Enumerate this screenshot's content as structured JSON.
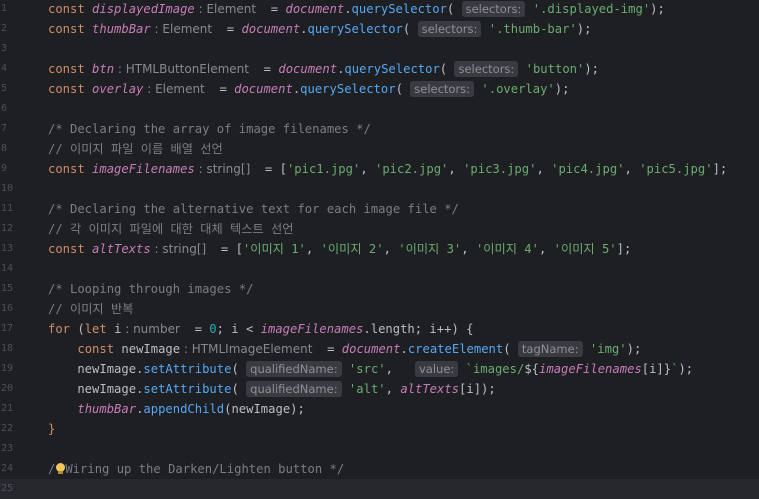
{
  "editor": {
    "lines": [
      {
        "n": "1",
        "tokens": [
          {
            "t": "kw",
            "v": "const "
          },
          {
            "t": "var",
            "v": "displayedImage"
          },
          {
            "t": "hint",
            "v": " : Element"
          },
          {
            "t": "txt",
            "v": "  = "
          },
          {
            "t": "var",
            "v": "document"
          },
          {
            "t": "txt",
            "v": "."
          },
          {
            "t": "fn",
            "v": "querySelector"
          },
          {
            "t": "txt",
            "v": "( "
          },
          {
            "t": "ph",
            "v": "selectors:"
          },
          {
            "t": "str",
            "v": " '.displayed-img'"
          },
          {
            "t": "txt",
            "v": ");"
          }
        ]
      },
      {
        "n": "2",
        "tokens": [
          {
            "t": "kw",
            "v": "const "
          },
          {
            "t": "var",
            "v": "thumbBar"
          },
          {
            "t": "hint",
            "v": " : Element"
          },
          {
            "t": "txt",
            "v": "  = "
          },
          {
            "t": "var",
            "v": "document"
          },
          {
            "t": "txt",
            "v": "."
          },
          {
            "t": "fn",
            "v": "querySelector"
          },
          {
            "t": "txt",
            "v": "( "
          },
          {
            "t": "ph",
            "v": "selectors:"
          },
          {
            "t": "str",
            "v": " '.thumb-bar'"
          },
          {
            "t": "txt",
            "v": ");"
          }
        ]
      },
      {
        "n": "3",
        "tokens": []
      },
      {
        "n": "4",
        "tokens": [
          {
            "t": "kw",
            "v": "const "
          },
          {
            "t": "var",
            "v": "btn"
          },
          {
            "t": "hint",
            "v": " : HTMLButtonElement"
          },
          {
            "t": "txt",
            "v": "  = "
          },
          {
            "t": "var",
            "v": "document"
          },
          {
            "t": "txt",
            "v": "."
          },
          {
            "t": "fn",
            "v": "querySelector"
          },
          {
            "t": "txt",
            "v": "( "
          },
          {
            "t": "ph",
            "v": "selectors:"
          },
          {
            "t": "str",
            "v": " 'button'"
          },
          {
            "t": "txt",
            "v": ");"
          }
        ]
      },
      {
        "n": "5",
        "tokens": [
          {
            "t": "kw",
            "v": "const "
          },
          {
            "t": "var",
            "v": "overlay"
          },
          {
            "t": "hint",
            "v": " : Element"
          },
          {
            "t": "txt",
            "v": "  = "
          },
          {
            "t": "var",
            "v": "document"
          },
          {
            "t": "txt",
            "v": "."
          },
          {
            "t": "fn",
            "v": "querySelector"
          },
          {
            "t": "txt",
            "v": "( "
          },
          {
            "t": "ph",
            "v": "selectors:"
          },
          {
            "t": "str",
            "v": " '.overlay'"
          },
          {
            "t": "txt",
            "v": ");"
          }
        ]
      },
      {
        "n": "6",
        "tokens": []
      },
      {
        "n": "7",
        "tokens": [
          {
            "t": "cmt",
            "v": "/* Declaring the array of image filenames */"
          }
        ]
      },
      {
        "n": "8",
        "tokens": [
          {
            "t": "cmt",
            "v": "// 이미지 파일 이름 배열 선언"
          }
        ]
      },
      {
        "n": "9",
        "tokens": [
          {
            "t": "kw",
            "v": "const "
          },
          {
            "t": "var",
            "v": "imageFilenames"
          },
          {
            "t": "hint",
            "v": " : string[]"
          },
          {
            "t": "txt",
            "v": "  = ["
          },
          {
            "t": "str",
            "v": "'pic1.jpg'"
          },
          {
            "t": "txt",
            "v": ", "
          },
          {
            "t": "str",
            "v": "'pic2.jpg'"
          },
          {
            "t": "txt",
            "v": ", "
          },
          {
            "t": "str",
            "v": "'pic3.jpg'"
          },
          {
            "t": "txt",
            "v": ", "
          },
          {
            "t": "str",
            "v": "'pic4.jpg'"
          },
          {
            "t": "txt",
            "v": ", "
          },
          {
            "t": "str",
            "v": "'pic5.jpg'"
          },
          {
            "t": "txt",
            "v": "];"
          }
        ]
      },
      {
        "n": "10",
        "tokens": []
      },
      {
        "n": "11",
        "tokens": [
          {
            "t": "cmt",
            "v": "/* Declaring the alternative text for each image file */"
          }
        ]
      },
      {
        "n": "12",
        "tokens": [
          {
            "t": "cmt",
            "v": "// 각 이미지 파일에 대한 대체 텍스트 선언"
          }
        ]
      },
      {
        "n": "13",
        "tokens": [
          {
            "t": "kw",
            "v": "const "
          },
          {
            "t": "var",
            "v": "altTexts"
          },
          {
            "t": "hint",
            "v": " : string[]"
          },
          {
            "t": "txt",
            "v": "  = ["
          },
          {
            "t": "str",
            "v": "'이미지 1'"
          },
          {
            "t": "txt",
            "v": ", "
          },
          {
            "t": "str",
            "v": "'이미지 2'"
          },
          {
            "t": "txt",
            "v": ", "
          },
          {
            "t": "str",
            "v": "'이미지 3'"
          },
          {
            "t": "txt",
            "v": ", "
          },
          {
            "t": "str",
            "v": "'이미지 4'"
          },
          {
            "t": "txt",
            "v": ", "
          },
          {
            "t": "str",
            "v": "'이미지 5'"
          },
          {
            "t": "txt",
            "v": "];"
          }
        ]
      },
      {
        "n": "14",
        "tokens": []
      },
      {
        "n": "15",
        "tokens": [
          {
            "t": "cmt",
            "v": "/* Looping through images */"
          }
        ]
      },
      {
        "n": "16",
        "tokens": [
          {
            "t": "cmt",
            "v": "// 이미지 반복"
          }
        ]
      },
      {
        "n": "17",
        "tokens": [
          {
            "t": "kw",
            "v": "for "
          },
          {
            "t": "txt",
            "v": "("
          },
          {
            "t": "kw",
            "v": "let "
          },
          {
            "t": "txt",
            "v": "i"
          },
          {
            "t": "hint",
            "v": " : number"
          },
          {
            "t": "txt",
            "v": "  = "
          },
          {
            "t": "num",
            "v": "0"
          },
          {
            "t": "txt",
            "v": "; i < "
          },
          {
            "t": "var",
            "v": "imageFilenames"
          },
          {
            "t": "txt",
            "v": ".length; i++) {"
          }
        ]
      },
      {
        "n": "18",
        "tokens": [
          {
            "t": "txt",
            "v": "    "
          },
          {
            "t": "kw",
            "v": "const "
          },
          {
            "t": "txt",
            "v": "newImage"
          },
          {
            "t": "hint",
            "v": " : HTMLImageElement"
          },
          {
            "t": "txt",
            "v": "  = "
          },
          {
            "t": "var",
            "v": "document"
          },
          {
            "t": "txt",
            "v": "."
          },
          {
            "t": "fn",
            "v": "createElement"
          },
          {
            "t": "txt",
            "v": "( "
          },
          {
            "t": "ph",
            "v": "tagName:"
          },
          {
            "t": "str",
            "v": " 'img'"
          },
          {
            "t": "txt",
            "v": ");"
          }
        ]
      },
      {
        "n": "19",
        "tokens": [
          {
            "t": "txt",
            "v": "    newImage."
          },
          {
            "t": "fn",
            "v": "setAttribute"
          },
          {
            "t": "txt",
            "v": "( "
          },
          {
            "t": "ph",
            "v": "qualifiedName:"
          },
          {
            "t": "str",
            "v": " 'src'"
          },
          {
            "t": "txt",
            "v": ",   "
          },
          {
            "t": "ph",
            "v": "value:"
          },
          {
            "t": "str",
            "v": " `images/"
          },
          {
            "t": "txt",
            "v": "${"
          },
          {
            "t": "var",
            "v": "imageFilenames"
          },
          {
            "t": "txt",
            "v": "[i]}"
          },
          {
            "t": "str",
            "v": "`"
          },
          {
            "t": "txt",
            "v": ");"
          }
        ]
      },
      {
        "n": "20",
        "tokens": [
          {
            "t": "txt",
            "v": "    newImage."
          },
          {
            "t": "fn",
            "v": "setAttribute"
          },
          {
            "t": "txt",
            "v": "( "
          },
          {
            "t": "ph",
            "v": "qualifiedName:"
          },
          {
            "t": "str",
            "v": " 'alt'"
          },
          {
            "t": "txt",
            "v": ", "
          },
          {
            "t": "var",
            "v": "altTexts"
          },
          {
            "t": "txt",
            "v": "[i]);"
          }
        ]
      },
      {
        "n": "21",
        "tokens": [
          {
            "t": "txt",
            "v": "    "
          },
          {
            "t": "var",
            "v": "thumbBar"
          },
          {
            "t": "txt",
            "v": "."
          },
          {
            "t": "fn",
            "v": "appendChild"
          },
          {
            "t": "txt",
            "v": "(newImage);"
          }
        ]
      },
      {
        "n": "22",
        "tokens": [
          {
            "t": "kw",
            "v": "}"
          }
        ]
      },
      {
        "n": "23",
        "tokens": []
      },
      {
        "n": "24",
        "tokens": [
          {
            "t": "cmt",
            "v": "/"
          },
          {
            "t": "bulb",
            "v": ""
          },
          {
            "t": "cmt",
            "v": "Wiring up the Darken/Lighten button */"
          }
        ]
      },
      {
        "n": "25",
        "tokens": []
      }
    ]
  }
}
